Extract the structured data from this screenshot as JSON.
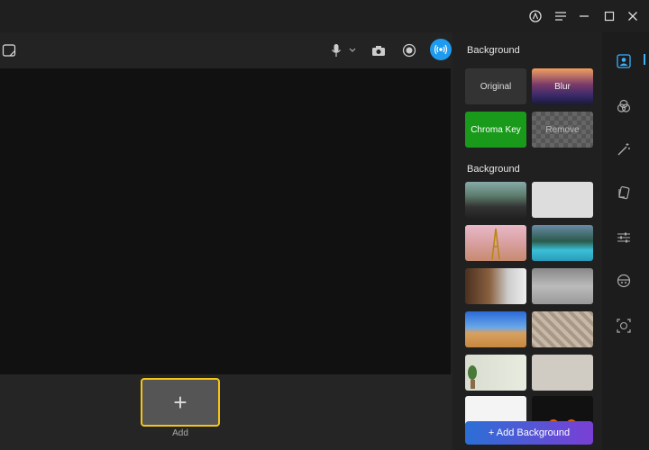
{
  "titlebar": {
    "icons": [
      "account-icon",
      "menu-icon",
      "minimize-icon",
      "maximize-icon",
      "close-icon"
    ]
  },
  "toolbar": {
    "icons": [
      "sticky-note-icon",
      "microphone-icon",
      "chevron-down-icon",
      "camera-icon",
      "record-icon",
      "live-broadcast-icon"
    ],
    "accent": "#1e9bef"
  },
  "preview": {
    "add_label": "Add",
    "add_symbol": "+",
    "highlight": "#f5c518"
  },
  "panel": {
    "section1_title": "Background",
    "options": {
      "original": "Original",
      "blur": "Blur",
      "chroma_key": "Chroma Key",
      "remove": "Remove"
    },
    "section2_title": "Background",
    "add_background_label": "+ Add Background",
    "chroma_color": "#1a9a1a"
  },
  "rail": {
    "icons": [
      "person-icon",
      "filters-icon",
      "magic-wand-icon",
      "sticker-icon",
      "adjustments-icon",
      "avatar-icon",
      "ar-face-icon"
    ],
    "active_color": "#3ab0ff"
  }
}
